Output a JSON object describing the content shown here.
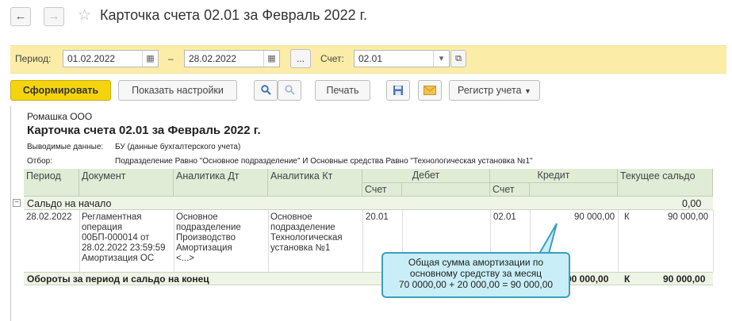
{
  "header": {
    "back_icon": "arrow-left-icon",
    "forward_icon": "arrow-right-icon",
    "favorite_icon": "star-icon",
    "title": "Карточка счета 02.01 за Февраль 2022 г."
  },
  "filters": {
    "period_label": "Период:",
    "date_from": "01.02.2022",
    "dash": "–",
    "date_to": "28.02.2022",
    "more_label": "...",
    "account_label": "Счет:",
    "account_value": "02.01"
  },
  "toolbar": {
    "generate_label": "Сформировать",
    "settings_label": "Показать настройки",
    "print_label": "Печать",
    "register_label": "Регистр учета"
  },
  "report": {
    "company": "Ромашка ООО",
    "title": "Карточка счета 02.01 за Февраль 2022 г.",
    "output_label": "Выводимые данные:",
    "output_value": "БУ (данные бухгалтерского учета)",
    "filter_label": "Отбор:",
    "filter_value": "Подразделение Равно \"Основное подразделение\" И Основные средства Равно \"Технологическая установка №1\"",
    "columns": {
      "period": "Период",
      "document": "Документ",
      "analytics_dt": "Аналитика Дт",
      "analytics_kt": "Аналитика Кт",
      "debit": "Дебет",
      "credit": "Кредит",
      "balance": "Текущее сальдо",
      "account": "Счет"
    },
    "opening": {
      "label": "Сальдо на начало",
      "value": "0,00"
    },
    "row": {
      "period": "28.02.2022",
      "document": "Регламентная\nоперация\n00БП-000014 от\n28.02.2022 23:59:59\nАмортизация ОС",
      "analytics_dt": "Основное\nподразделение\nПроизводство\nАмортизация\n<...>",
      "analytics_kt": "Основное\nподразделение\nТехнологическая\nустановка №1",
      "debit_account": "20.01",
      "credit_account": "02.01",
      "credit_amount": "90 000,00",
      "balance_side": "К",
      "balance_amount": "90 000,00"
    },
    "totals": {
      "label": "Обороты за период и сальдо на конец",
      "credit_amount": "90 000,00",
      "balance_side": "К",
      "balance_amount": "90 000,00"
    }
  },
  "callout": {
    "line1": "Общая сумма амортизации по",
    "line2": "основному средству за месяц",
    "line3": "70 0000,00 + 20 000,00 = 90 000,00"
  }
}
